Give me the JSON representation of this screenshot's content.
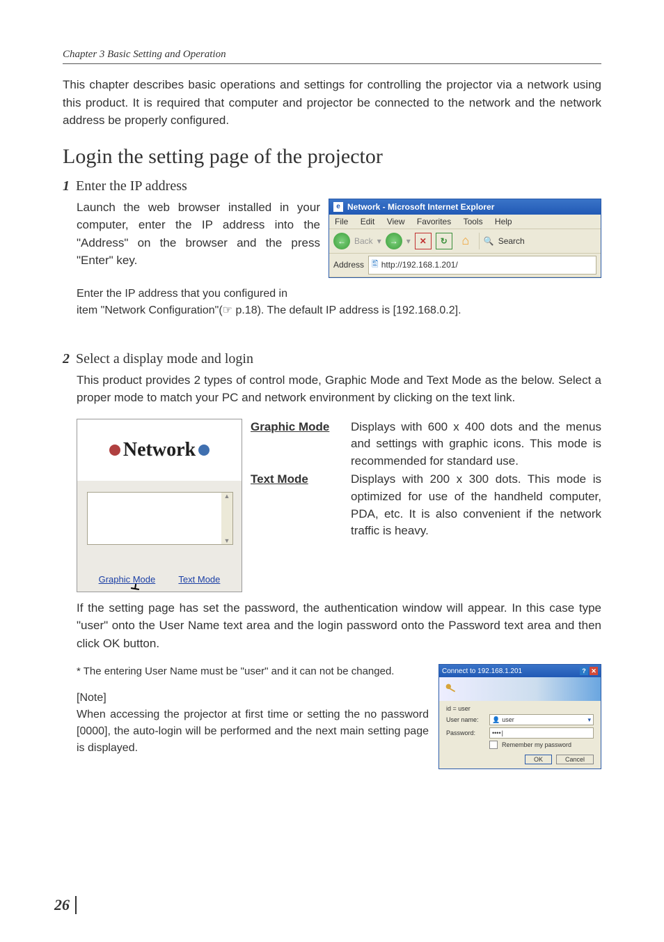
{
  "header": {
    "chapter": "Chapter 3 Basic Setting and Operation"
  },
  "intro": "This chapter describes basic operations and settings for controlling the projector via a network using this product. It is required that computer and projector be connected to the network and the network address be properly configured.",
  "section_title": "Login the setting page of the projector",
  "step1": {
    "num": "1",
    "title": "Enter the IP address",
    "body": "Launch the web browser installed in your computer, enter the IP address into the \"Address\" on the browser and the press \"Enter\" key.",
    "continuation_a": "Enter the IP address that you configured in",
    "continuation_b": "item \"Network Configuration\"(☞ p.18). The default IP address is [192.168.0.2]."
  },
  "ie": {
    "title": "Network - Microsoft Internet Explorer",
    "menu": {
      "file": "File",
      "edit": "Edit",
      "view": "View",
      "favorites": "Favorites",
      "tools": "Tools",
      "help": "Help"
    },
    "toolbar": {
      "back": "Back",
      "search": "Search"
    },
    "address_label": "Address",
    "address_value": "http://192.168.1.201/"
  },
  "step2": {
    "num": "2",
    "title": "Select a display mode and login",
    "body": "This product provides 2 types of control mode, Graphic Mode and Text Mode as the below. Select a proper mode to match your PC and network environment by clicking on the text link."
  },
  "network_card": {
    "logo_text": "Network",
    "links": {
      "graphic": "Graphic Mode",
      "text": "Text Mode"
    }
  },
  "modes": {
    "graphic": {
      "term": "Graphic Mode",
      "def": "Displays with 600 x 400 dots and the menus and settings with graphic icons. This mode is recommended for standard use."
    },
    "text": {
      "term": "Text Mode",
      "def": "Displays with 200 x 300 dots. This mode is optimized for use of the handheld computer, PDA, etc. It is also convenient if the network traffic is heavy."
    }
  },
  "after": {
    "p1a": "If the setting page has set the password, the authentication window will appear. In this case type \"user\" onto the ",
    "p1b": "User Name",
    "p1c": " text area and the login password onto the ",
    "p1d": "Password",
    "p1e": " text area and then click ",
    "p1f": "OK",
    "p1g": " button.",
    "note_star": "* The entering User Name must be \"user\" and it can not be changed.",
    "note_label": "[Note]",
    "note_body": "When accessing the projector at first time or setting the no password [0000], the auto-login will be performed and the next main setting page is displayed."
  },
  "auth": {
    "title": "Connect to 192.168.1.201",
    "realm": "id = user",
    "username_label": "User name:",
    "password_label": "Password:",
    "username_value": "user",
    "password_value": "••••",
    "remember": "Remember my password",
    "ok": "OK",
    "cancel": "Cancel"
  },
  "page_number": "26"
}
